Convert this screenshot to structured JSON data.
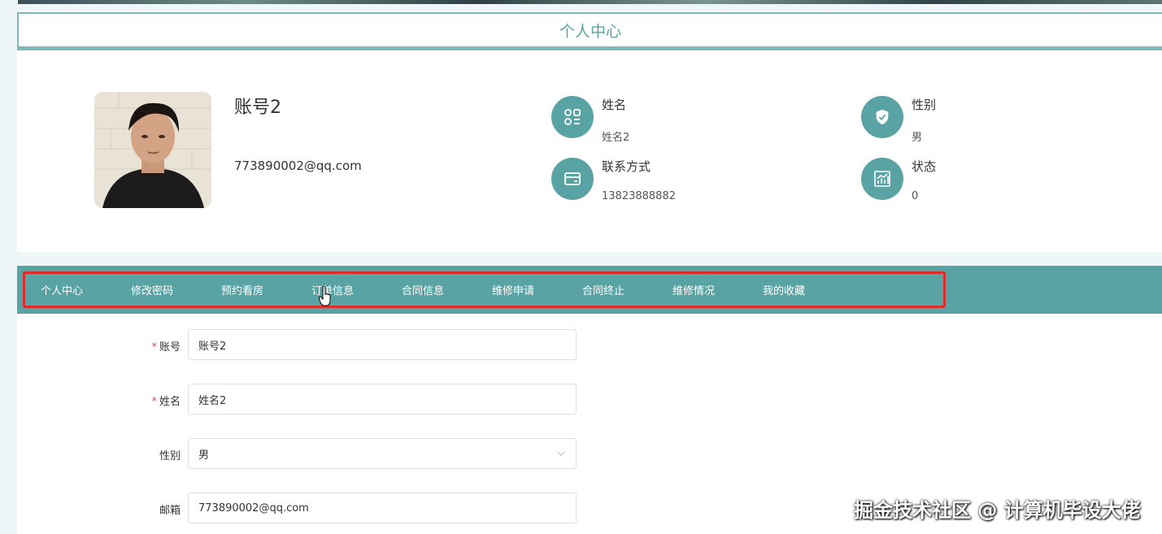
{
  "page_title": "个人中心",
  "profile": {
    "account": "账号2",
    "email": "773890002@qq.com",
    "fields": [
      {
        "label": "姓名",
        "value": "姓名2",
        "icon": "apps-icon"
      },
      {
        "label": "性别",
        "value": "男",
        "icon": "shield-check-icon"
      },
      {
        "label": "联系方式",
        "value": "13823888882",
        "icon": "wallet-card-icon"
      },
      {
        "label": "状态",
        "value": "0",
        "icon": "chart-icon"
      }
    ]
  },
  "nav": {
    "items": [
      "个人中心",
      "修改密码",
      "预约看房",
      "订单信息",
      "合同信息",
      "维修申请",
      "合同终止",
      "维修情况",
      "我的收藏"
    ],
    "active_index": 0,
    "highlight_color": "#e02b2b"
  },
  "form": {
    "account_label": "账号",
    "account_value": "账号2",
    "name_label": "姓名",
    "name_value": "姓名2",
    "gender_label": "性别",
    "gender_value": "男",
    "email_label": "邮箱",
    "email_value": "773890002@qq.com",
    "required_mark": "*"
  },
  "colors": {
    "accent": "#5aa3a5",
    "border": "#7fb8b6"
  },
  "watermark": "掘金技术社区 @ 计算机毕设大佬"
}
